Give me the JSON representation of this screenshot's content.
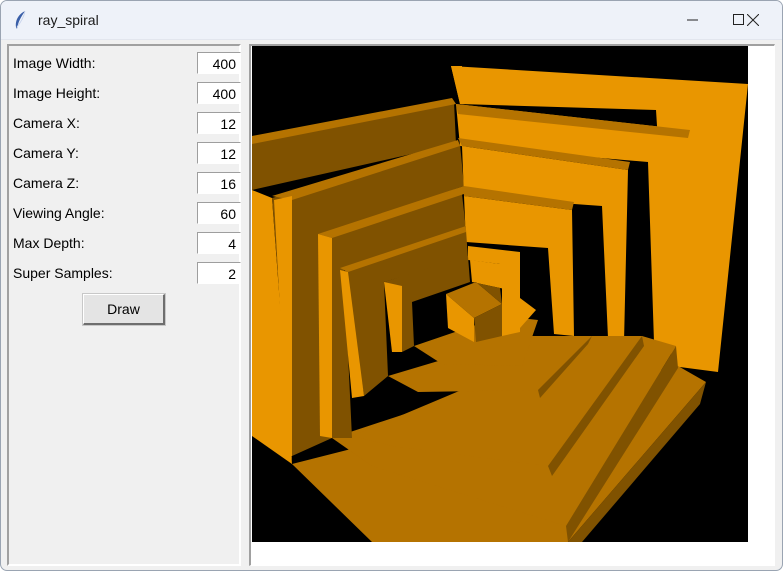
{
  "window": {
    "title": "ray_spiral",
    "icon": "feather-icon",
    "controls": [
      "minimize-icon",
      "maximize-icon",
      "close-icon"
    ]
  },
  "form": {
    "fields": [
      {
        "label": "Image Width:",
        "value": "400"
      },
      {
        "label": "Image Height:",
        "value": "400"
      },
      {
        "label": "Camera X:",
        "value": "12"
      },
      {
        "label": "Camera Y:",
        "value": "12"
      },
      {
        "label": "Camera Z:",
        "value": "16"
      },
      {
        "label": "Viewing Angle:",
        "value": "60"
      },
      {
        "label": "Max Depth:",
        "value": "4"
      },
      {
        "label": "Super Samples:",
        "value": "2"
      }
    ],
    "draw_label": "Draw"
  },
  "render": {
    "background": "#000000",
    "colors": {
      "top": "#e99600",
      "front": "#b57300",
      "side": "#805200"
    }
  }
}
